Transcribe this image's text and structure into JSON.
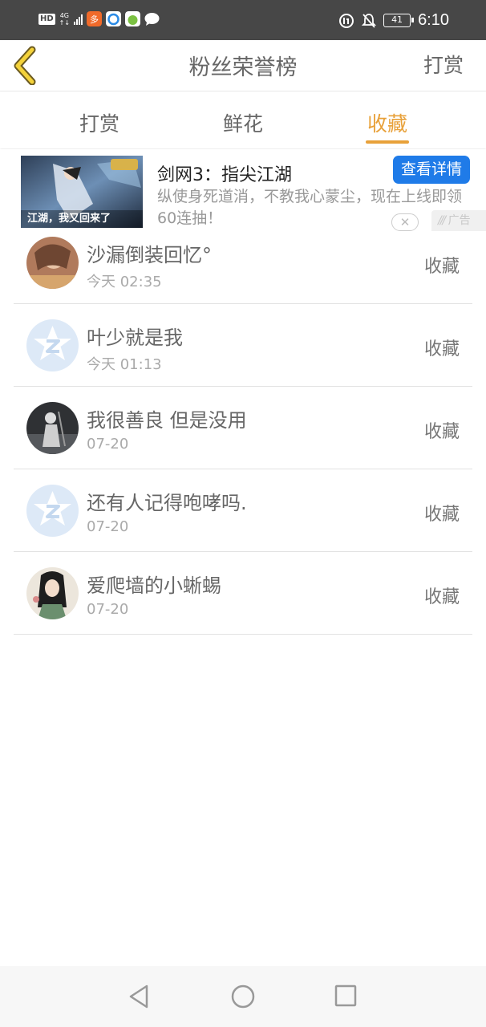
{
  "statusbar": {
    "hd": "HD",
    "net_type": "4G",
    "net_sub": "↑↓",
    "battery": "41",
    "time": "6:10"
  },
  "header": {
    "title": "粉丝荣誉榜",
    "right_action": "打赏",
    "back_icon": "chevron-left-icon"
  },
  "tabs": [
    {
      "label": "打赏",
      "active": false
    },
    {
      "label": "鲜花",
      "active": false
    },
    {
      "label": "收藏",
      "active": true
    }
  ],
  "ad": {
    "image_caption": "江湖，我又回来了",
    "title": "剑网3：指尖江湖",
    "description": "纵使身死道消，不教我心蒙尘，现在上线即领60连抽！",
    "cta": "查看详情",
    "close_label": "✕",
    "tag": "广告"
  },
  "list": [
    {
      "name": "沙漏倒装回忆°",
      "time": "今天 02:35",
      "action": "收藏",
      "avatar": "photo-brown"
    },
    {
      "name": "叶少就是我",
      "time": "今天 01:13",
      "action": "收藏",
      "avatar": "default-qq"
    },
    {
      "name": "我很善良 但是没用",
      "time": "07-20",
      "action": "收藏",
      "avatar": "photo-dark"
    },
    {
      "name": "还有人记得咆哮吗.",
      "time": "07-20",
      "action": "收藏",
      "avatar": "default-qq"
    },
    {
      "name": "爱爬墙的小蜥蜴",
      "time": "07-20",
      "action": "收藏",
      "avatar": "photo-anime"
    }
  ],
  "colors": {
    "accent": "#e8a13a",
    "statusbar": "#474747",
    "ad_button": "#1f7be8"
  },
  "bottom_nav": [
    "back-triangle-icon",
    "home-circle-icon",
    "recents-square-icon"
  ]
}
